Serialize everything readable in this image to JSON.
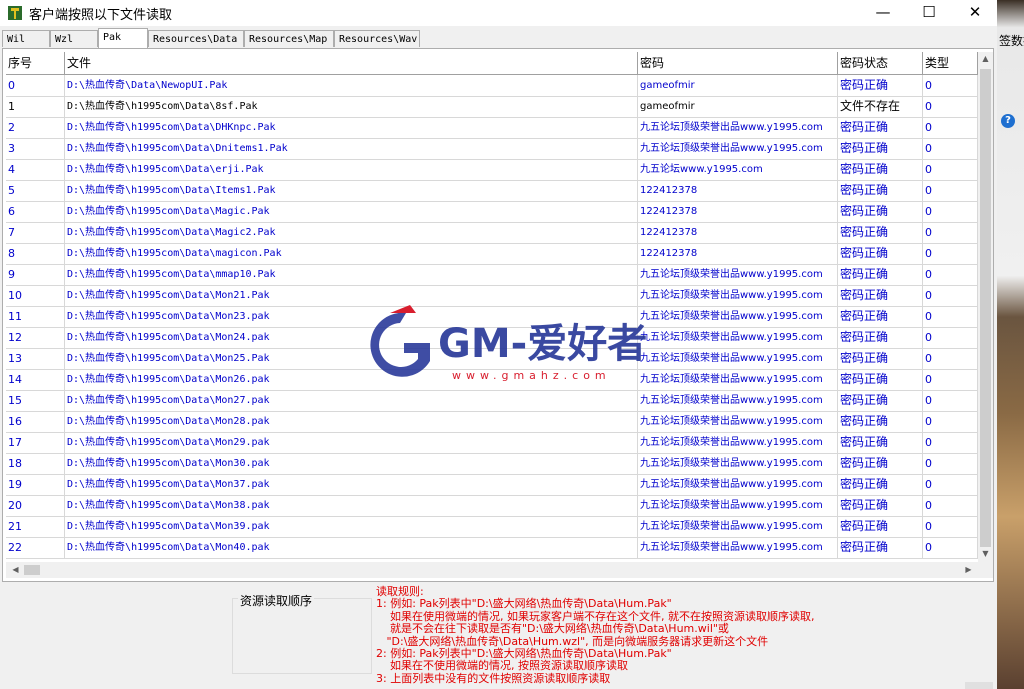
{
  "window": {
    "title": "客户端按照以下文件读取",
    "min_symbol": "—",
    "max_symbol": "☐",
    "close_symbol": "✕"
  },
  "background": {
    "fragment_text": "签数据",
    "help_symbol": "?"
  },
  "tabs": [
    {
      "label": "Wil",
      "active": false
    },
    {
      "label": "Wzl",
      "active": false
    },
    {
      "label": "Pak",
      "active": true
    },
    {
      "label": "Resources\\Data",
      "active": false
    },
    {
      "label": "Resources\\Map",
      "active": false
    },
    {
      "label": "Resources\\Wav",
      "active": false
    }
  ],
  "table": {
    "columns": [
      "序号",
      "文件",
      "密码",
      "密码状态",
      "类型"
    ],
    "rows": [
      {
        "id": "0",
        "file": "D:\\热血传奇\\Data\\NewopUI.Pak",
        "password": "gameofmir",
        "status": "密码正确",
        "type": "0"
      },
      {
        "id": "1",
        "file": "D:\\热血传奇\\h1995com\\Data\\8sf.Pak",
        "password": "gameofmir",
        "status": "文件不存在",
        "type": "0"
      },
      {
        "id": "2",
        "file": "D:\\热血传奇\\h1995com\\Data\\DHKnpc.Pak",
        "password": "九五论坛顶级荣誉出品www.y1995.com",
        "status": "密码正确",
        "type": "0"
      },
      {
        "id": "3",
        "file": "D:\\热血传奇\\h1995com\\Data\\Dnitems1.Pak",
        "password": "九五论坛顶级荣誉出品www.y1995.com",
        "status": "密码正确",
        "type": "0"
      },
      {
        "id": "4",
        "file": "D:\\热血传奇\\h1995com\\Data\\erji.Pak",
        "password": "九五论坛www.y1995.com",
        "status": "密码正确",
        "type": "0"
      },
      {
        "id": "5",
        "file": "D:\\热血传奇\\h1995com\\Data\\Items1.Pak",
        "password": "122412378",
        "status": "密码正确",
        "type": "0"
      },
      {
        "id": "6",
        "file": "D:\\热血传奇\\h1995com\\Data\\Magic.Pak",
        "password": "122412378",
        "status": "密码正确",
        "type": "0"
      },
      {
        "id": "7",
        "file": "D:\\热血传奇\\h1995com\\Data\\Magic2.Pak",
        "password": "122412378",
        "status": "密码正确",
        "type": "0"
      },
      {
        "id": "8",
        "file": "D:\\热血传奇\\h1995com\\Data\\magicon.Pak",
        "password": "122412378",
        "status": "密码正确",
        "type": "0"
      },
      {
        "id": "9",
        "file": "D:\\热血传奇\\h1995com\\Data\\mmap10.Pak",
        "password": "九五论坛顶级荣誉出品www.y1995.com",
        "status": "密码正确",
        "type": "0"
      },
      {
        "id": "10",
        "file": "D:\\热血传奇\\h1995com\\Data\\Mon21.Pak",
        "password": "九五论坛顶级荣誉出品www.y1995.com",
        "status": "密码正确",
        "type": "0"
      },
      {
        "id": "11",
        "file": "D:\\热血传奇\\h1995com\\Data\\Mon23.pak",
        "password": "九五论坛顶级荣誉出品www.y1995.com",
        "status": "密码正确",
        "type": "0"
      },
      {
        "id": "12",
        "file": "D:\\热血传奇\\h1995com\\Data\\Mon24.pak",
        "password": "九五论坛顶级荣誉出品www.y1995.com",
        "status": "密码正确",
        "type": "0"
      },
      {
        "id": "13",
        "file": "D:\\热血传奇\\h1995com\\Data\\Mon25.Pak",
        "password": "九五论坛顶级荣誉出品www.y1995.com",
        "status": "密码正确",
        "type": "0"
      },
      {
        "id": "14",
        "file": "D:\\热血传奇\\h1995com\\Data\\Mon26.pak",
        "password": "九五论坛顶级荣誉出品www.y1995.com",
        "status": "密码正确",
        "type": "0"
      },
      {
        "id": "15",
        "file": "D:\\热血传奇\\h1995com\\Data\\Mon27.pak",
        "password": "九五论坛顶级荣誉出品www.y1995.com",
        "status": "密码正确",
        "type": "0"
      },
      {
        "id": "16",
        "file": "D:\\热血传奇\\h1995com\\Data\\Mon28.pak",
        "password": "九五论坛顶级荣誉出品www.y1995.com",
        "status": "密码正确",
        "type": "0"
      },
      {
        "id": "17",
        "file": "D:\\热血传奇\\h1995com\\Data\\Mon29.pak",
        "password": "九五论坛顶级荣誉出品www.y1995.com",
        "status": "密码正确",
        "type": "0"
      },
      {
        "id": "18",
        "file": "D:\\热血传奇\\h1995com\\Data\\Mon30.pak",
        "password": "九五论坛顶级荣誉出品www.y1995.com",
        "status": "密码正确",
        "type": "0"
      },
      {
        "id": "19",
        "file": "D:\\热血传奇\\h1995com\\Data\\Mon37.pak",
        "password": "九五论坛顶级荣誉出品www.y1995.com",
        "status": "密码正确",
        "type": "0"
      },
      {
        "id": "20",
        "file": "D:\\热血传奇\\h1995com\\Data\\Mon38.pak",
        "password": "九五论坛顶级荣誉出品www.y1995.com",
        "status": "密码正确",
        "type": "0"
      },
      {
        "id": "21",
        "file": "D:\\热血传奇\\h1995com\\Data\\Mon39.pak",
        "password": "九五论坛顶级荣誉出品www.y1995.com",
        "status": "密码正确",
        "type": "0"
      },
      {
        "id": "22",
        "file": "D:\\热血传奇\\h1995com\\Data\\Mon40.pak",
        "password": "九五论坛顶级荣誉出品www.y1995.com",
        "status": "密码正确",
        "type": "0"
      }
    ]
  },
  "resource_group": {
    "label": "资源读取顺序"
  },
  "rules_text": "读取规则:\n1: 例如: Pak列表中\"D:\\盛大网络\\热血传奇\\Data\\Hum.Pak\"\n    如果在使用微端的情况, 如果玩家客户端不存在这个文件, 就不在按照资源读取顺序读取,\n    就是不会在往下读取是否有\"D:\\盛大网络\\热血传奇\\Data\\Hum.wil\"或\n   \"D:\\盛大网络\\热血传奇\\Data\\Hum.wzl\", 而是向微端服务器请求更新这个文件\n2: 例如: Pak列表中\"D:\\盛大网络\\热血传奇\\Data\\Hum.Pak\"\n    如果在不使用微端的情况, 按照资源读取顺序读取\n3: 上面列表中没有的文件按照资源读取顺序读取",
  "watermark": {
    "brand": "GM-爱好者",
    "url": "www.gmahz.com"
  },
  "colors": {
    "accent_blue": "#0000cc",
    "rules_red": "#e00000",
    "watermark_blue": "#2a3a9a",
    "watermark_red": "#d81e2e"
  }
}
